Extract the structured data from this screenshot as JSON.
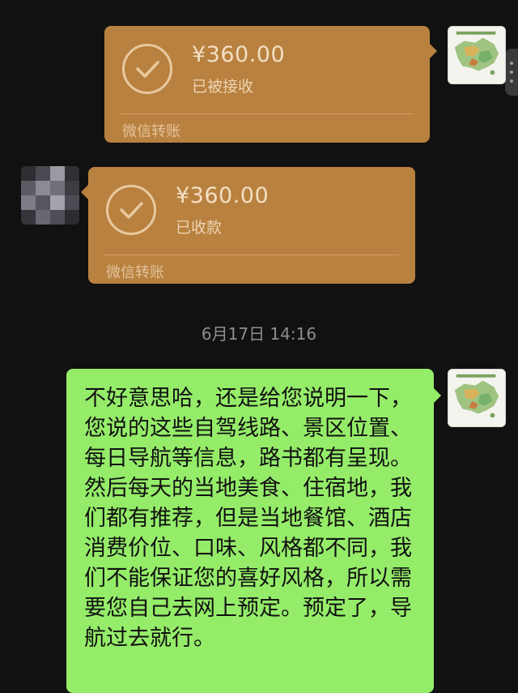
{
  "messages": [
    {
      "type": "transfer",
      "side": "right",
      "amount": "¥360.00",
      "status": "已被接收",
      "footer": "微信转账",
      "icon": "check-circle-icon"
    },
    {
      "type": "transfer",
      "side": "left",
      "amount": "¥360.00",
      "status": "已收款",
      "footer": "微信转账",
      "icon": "check-circle-icon"
    },
    {
      "type": "timestamp",
      "text": "6月17日 14:16"
    },
    {
      "type": "text",
      "side": "right",
      "text": "不好意思哈，还是给您说明一下，您说的这些自驾线路、景区位置、每日导航等信息，路书都有呈现。然后每天的当地美食、住宿地，我们都有推荐，但是当地餐馆、酒店消费价位、口味、风格都不同，我们不能保证您的喜好风格，所以需要您自己去网上预定。预定了，导航过去就行。"
    }
  ],
  "colors": {
    "background": "#111111",
    "transfer_bubble": "#b9813f",
    "text_bubble": "#95ec69",
    "timestamp": "#8e8e8e"
  }
}
